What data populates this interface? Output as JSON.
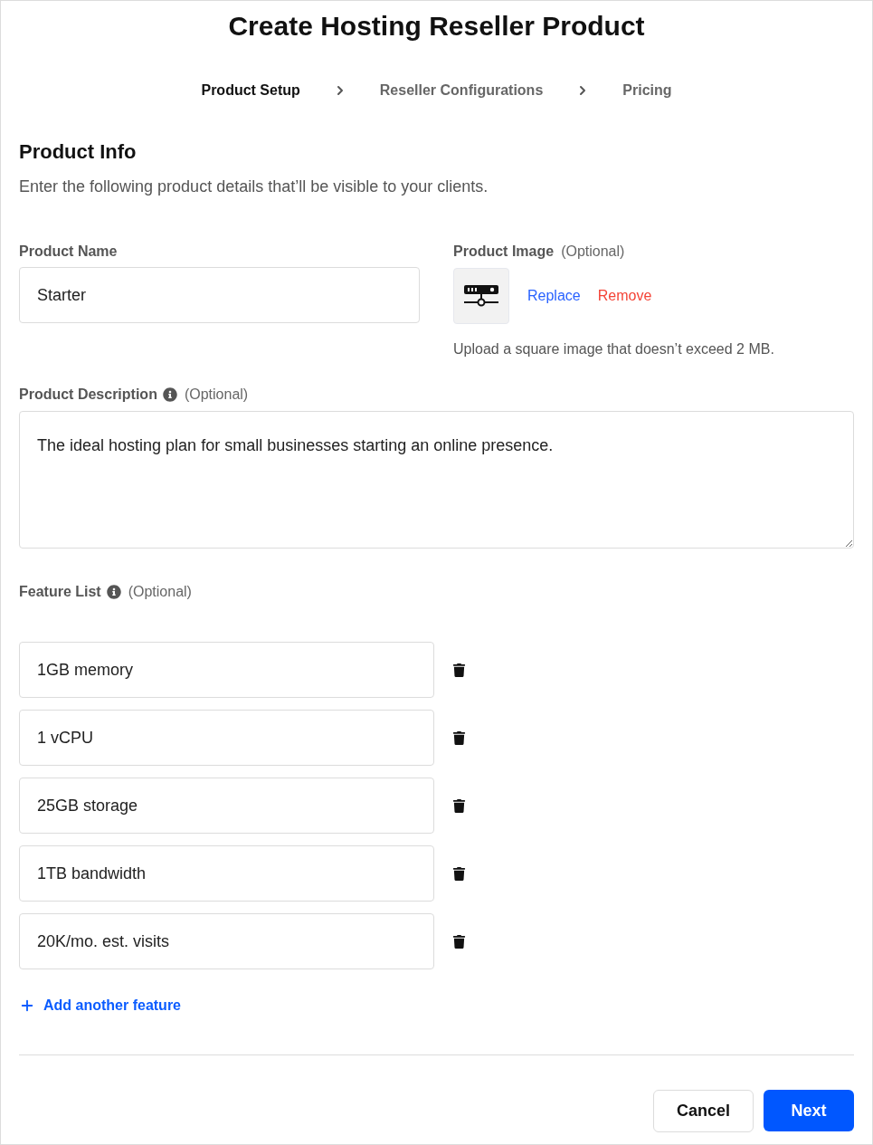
{
  "title": "Create Hosting Reseller Product",
  "steps": [
    {
      "label": "Product Setup",
      "selected": true
    },
    {
      "label": "Reseller Configurations",
      "selected": false
    },
    {
      "label": "Pricing",
      "selected": false
    }
  ],
  "section": {
    "heading": "Product Info",
    "subtitle": "Enter the following product details that’ll be visible to your clients."
  },
  "product_name": {
    "label": "Product Name",
    "value": "Starter"
  },
  "product_image": {
    "label": "Product Image",
    "optional": "(Optional)",
    "replace": "Replace",
    "remove": "Remove",
    "hint": "Upload a square image that doesn’t exceed 2 MB."
  },
  "product_description": {
    "label": "Product Description",
    "optional": "(Optional)",
    "value": "The ideal hosting plan for small businesses starting an online presence."
  },
  "feature_list": {
    "label": "Feature List",
    "optional": "(Optional)",
    "features": [
      "1GB memory",
      "1 vCPU",
      "25GB storage",
      "1TB bandwidth",
      "20K/mo. est. visits"
    ],
    "add_label": "Add another feature"
  },
  "buttons": {
    "cancel": "Cancel",
    "next": "Next"
  }
}
